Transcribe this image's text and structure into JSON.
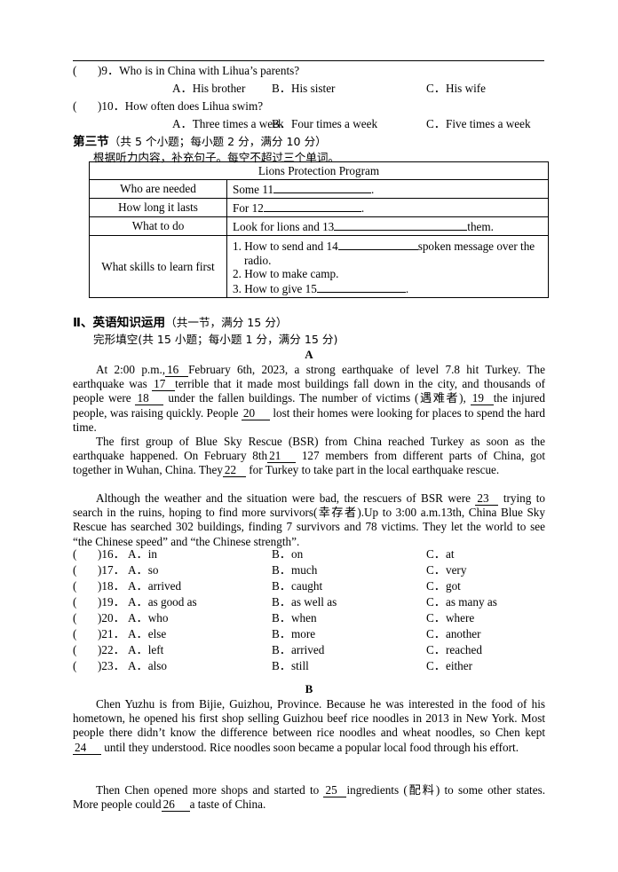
{
  "document": {
    "listening": {
      "questions": [
        {
          "num": "9",
          "paren_open": "(",
          "paren_close": ")",
          "stem": "．Who is in China with Lihua’s parents?",
          "options": [
            "A．His brother",
            "B．His sister",
            "C．His wife"
          ]
        },
        {
          "num": "10",
          "paren_open": "(",
          "paren_close": ")",
          "stem": "．How often does Lihua swim?",
          "options": [
            "A．Three times a week",
            "B．Four times a week",
            "C．Five times a week"
          ]
        }
      ],
      "section_heading": "第三节",
      "section_points": "（共 5 个小题；每小题 2 分，满分 10 分）",
      "section_instruction": "根据听力内容，补充句子。每空不超过三个单词。"
    },
    "table": {
      "title": "Lions Protection Program",
      "rows": [
        {
          "label": "Who are needed",
          "value_pre": "Some 11",
          "value_post": "."
        },
        {
          "label": "How long it lasts",
          "value_pre": "For 12",
          "value_post": "."
        },
        {
          "label": "What to do",
          "value_pre": "Look for lions and 13",
          "value_post": "them."
        }
      ],
      "skills_label": "What skills to learn first",
      "skills": [
        {
          "pre": "1. How to send and 14",
          "post": "spoken message over the",
          "cont": "radio."
        },
        {
          "pre": "2. How to make camp.",
          "post": "",
          "cont": ""
        },
        {
          "pre": "3. How to give 15",
          "post": ".",
          "cont": ""
        }
      ]
    },
    "section_two": {
      "heading": "Ⅱ、英语知识运用",
      "heading_points": "（共一节，满分 15 分）",
      "subheading": "完形填空(共 15 小题；每小题 1 分，满分 15 分)"
    },
    "passage_a": {
      "letter": "A",
      "paragraphs": [
        {
          "id": "a1",
          "parts": [
            {
              "t": "text",
              "v": "At 2:00 p.m.,"
            },
            {
              "t": "blank",
              "v": "16"
            },
            {
              "t": "text",
              "v": "February 6th, 2023, a strong earthquake of level 7.8 hit Turkey. The earthquake was"
            },
            {
              "t": "blank",
              "v": "17"
            },
            {
              "t": "text",
              "v": "terrible that it made most buildings fall down in the city, and thousands of people were"
            },
            {
              "t": "blank",
              "v": "18"
            },
            {
              "t": "text",
              "v": "under the fallen buildings. The number of victims (遇难者),"
            },
            {
              "t": "blank",
              "v": "19"
            },
            {
              "t": "text",
              "v": "the injured people, was raising quickly. People"
            },
            {
              "t": "blank",
              "v": "20"
            },
            {
              "t": "text",
              "v": "lost their homes were looking for places to spend the hard time."
            }
          ]
        },
        {
          "id": "a2",
          "parts": [
            {
              "t": "text",
              "v": "The first group of Blue Sky Rescue (BSR) from China reached Turkey as soon as the earthquake happened. On February 8th"
            },
            {
              "t": "blank",
              "v": "21"
            },
            {
              "t": "text",
              "v": "127 members from different parts of China, got together in Wuhan, China. They"
            },
            {
              "t": "blank",
              "v": "22"
            },
            {
              "t": "text",
              "v": "for Turkey to take part in the local earthquake rescue."
            }
          ]
        },
        {
          "id": "a3",
          "parts": [
            {
              "t": "text",
              "v": "Although the weather and the situation were bad, the rescuers of BSR were"
            },
            {
              "t": "blank",
              "v": "23"
            },
            {
              "t": "text",
              "v": "trying to search in the ruins, hoping to find more survivors(幸存者).Up to 3:00 a.m.13th, China Blue Sky Rescue has searched 302 buildings, finding 7 survivors and 78 victims. They let the world to see “the Chinese speed” and “the Chinese strength”."
            }
          ]
        }
      ],
      "choices": [
        {
          "num": "16",
          "paren_open": "(",
          "paren_close": ")",
          "a": "A．in",
          "b": "B．on",
          "c": "C．at"
        },
        {
          "num": "17",
          "paren_open": "(",
          "paren_close": ")",
          "a": "A．so",
          "b": "B．much",
          "c": "C．very"
        },
        {
          "num": "18",
          "paren_open": "(",
          "paren_close": ")",
          "a": "A．arrived",
          "b": "B．caught",
          "c": "C．got"
        },
        {
          "num": "19",
          "paren_open": "(",
          "paren_close": ")",
          "a": "A．as good as",
          "b": "B．as well as",
          "c": "C．as many as"
        },
        {
          "num": "20",
          "paren_open": "(",
          "paren_close": ")",
          "a": "A．who",
          "b": "B．when",
          "c": "C．where"
        },
        {
          "num": "21",
          "paren_open": "(",
          "paren_close": ")",
          "a": "A．else",
          "b": "B．more",
          "c": "C．another"
        },
        {
          "num": "22",
          "paren_open": "(",
          "paren_close": ")",
          "a": "A．left",
          "b": "B．arrived",
          "c": "C．reached"
        },
        {
          "num": "23",
          "paren_open": "(",
          "paren_close": ")",
          "a": "A．also",
          "b": "B．still",
          "c": "C．either"
        }
      ]
    },
    "passage_b": {
      "letter": "B",
      "paragraphs": [
        {
          "id": "b1",
          "parts": [
            {
              "t": "text",
              "v": "Chen Yuzhu is from Bijie, Guizhou, Province. Because he was interested in the food of his hometown, he opened his first shop selling Guizhou beef rice noodles in 2013 in New York. Most people there didn’t know the difference between rice noodles and wheat noodles, so Chen kept"
            },
            {
              "t": "blank",
              "v": "24"
            },
            {
              "t": "text",
              "v": "until they understood. Rice noodles soon became a popular local food through his effort."
            }
          ]
        },
        {
          "id": "b2",
          "parts": [
            {
              "t": "text",
              "v": "Then Chen opened more shops and started to"
            },
            {
              "t": "blank",
              "v": "25"
            },
            {
              "t": "text",
              "v": "ingredients (配料) to some other states. More people could"
            },
            {
              "t": "blank",
              "v": "26"
            },
            {
              "t": "text",
              "v": "a taste of China."
            }
          ]
        }
      ]
    }
  }
}
